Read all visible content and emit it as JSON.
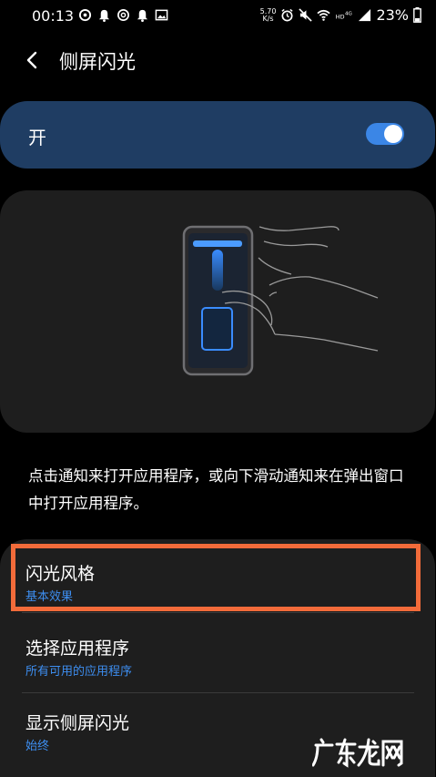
{
  "status_bar": {
    "time": "00:13",
    "net_speed_value": "5.70",
    "net_speed_unit": "K/s",
    "battery": "23%",
    "icons": [
      "netease-icon",
      "notification-bell-icon",
      "at-icon",
      "notification-bell-icon",
      "gallery-icon",
      "alarm-icon",
      "mute-icon",
      "wifi-icon",
      "hd-4g-icon",
      "signal-icon",
      "battery-icon"
    ]
  },
  "header": {
    "back_icon": "chevron-left-icon",
    "title": "侧屏闪光"
  },
  "master_switch": {
    "label": "开",
    "state": "on",
    "accent_color": "#3b86e6",
    "bar_color": "#1f3d63"
  },
  "description": "点击通知来打开应用程序，或向下滑动通知来在弹出窗口中打开应用程序。",
  "settings": [
    {
      "title": "闪光风格",
      "subtitle": "基本效果"
    },
    {
      "title": "选择应用程序",
      "subtitle": "所有可用的应用程序"
    },
    {
      "title": "显示侧屏闪光",
      "subtitle": "始终"
    }
  ],
  "highlight_color": "#f26b3a",
  "subtitle_color": "#3d8ef0",
  "watermark": "广东龙网"
}
